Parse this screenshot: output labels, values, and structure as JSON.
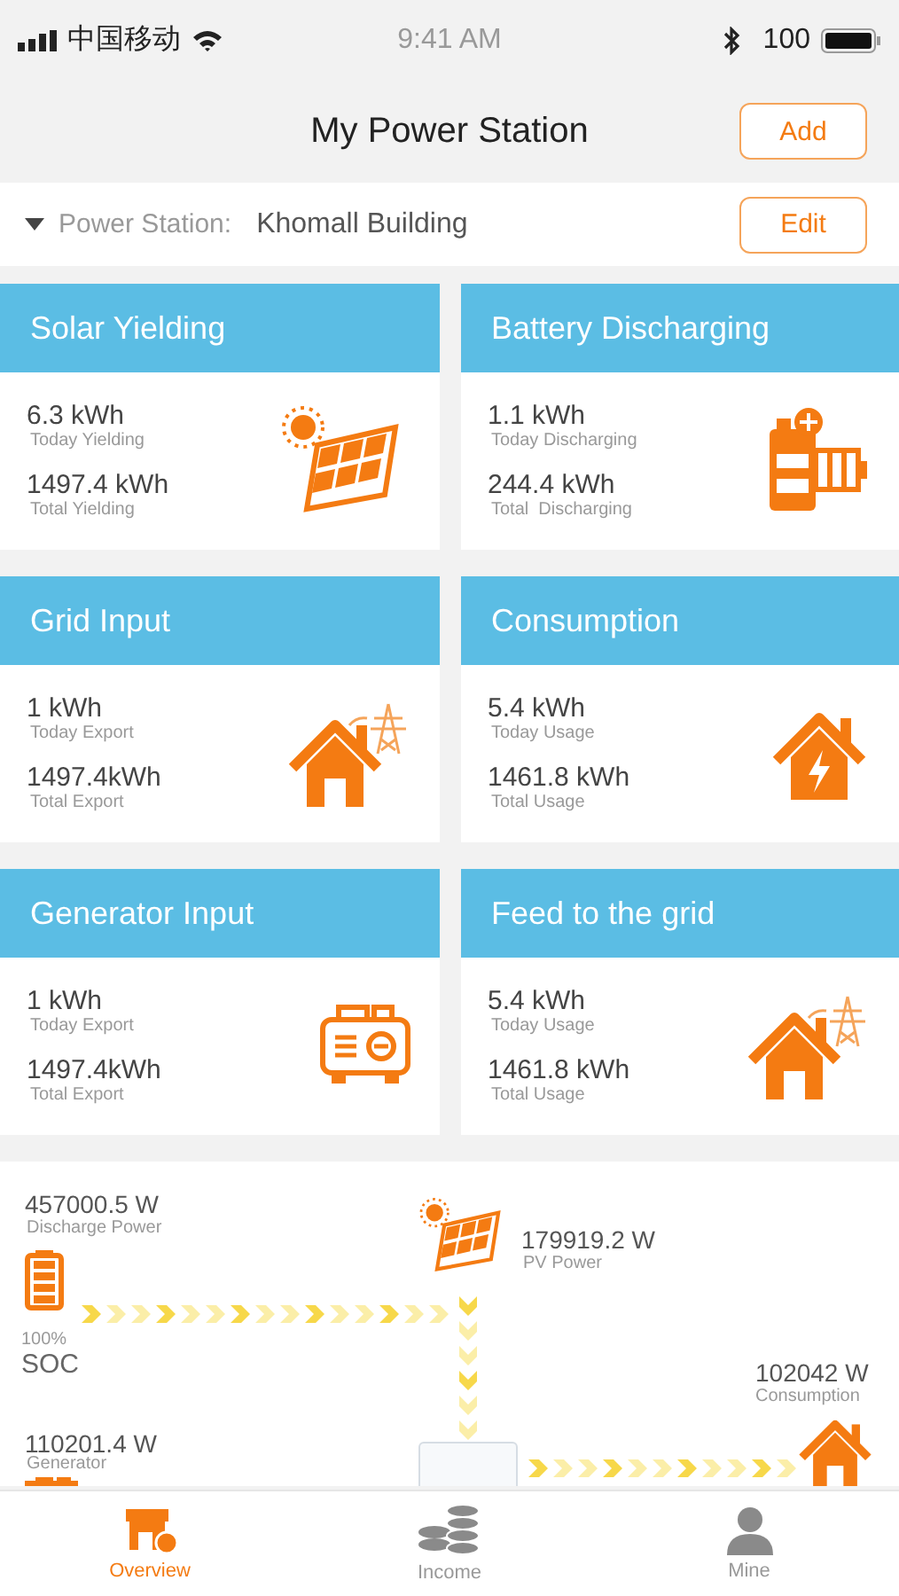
{
  "status_bar": {
    "carrier": "中国移动",
    "time": "9:41 AM",
    "battery": "100"
  },
  "header": {
    "title": "My Power Station",
    "add_button": "Add"
  },
  "station": {
    "label": "Power Station:",
    "name": "Khomall Building",
    "edit_button": "Edit"
  },
  "cards": [
    {
      "title": "Solar Yielding",
      "kind": "solar",
      "stats": [
        {
          "value": "6.3 kWh",
          "label": "Today Yielding"
        },
        {
          "value": "1497.4 kWh",
          "label": "Total Yielding"
        }
      ]
    },
    {
      "title": "Battery Discharging",
      "kind": "battery",
      "stats": [
        {
          "value": "1.1 kWh",
          "label": "Today Discharging"
        },
        {
          "value": "244.4 kWh",
          "label": "Total  Discharging"
        }
      ]
    },
    {
      "title": "Grid Input",
      "kind": "grid",
      "stats": [
        {
          "value": "1 kWh",
          "label": "Today Export"
        },
        {
          "value": "1497.4kWh",
          "label": "Total Export"
        }
      ]
    },
    {
      "title": "Consumption",
      "kind": "consumption",
      "stats": [
        {
          "value": "5.4 kWh",
          "label": "Today Usage"
        },
        {
          "value": "1461.8 kWh",
          "label": "Total Usage"
        }
      ]
    },
    {
      "title": "Generator Input",
      "kind": "generator",
      "stats": [
        {
          "value": "1 kWh",
          "label": "Today Export"
        },
        {
          "value": "1497.4kWh",
          "label": "Total Export"
        }
      ]
    },
    {
      "title": "Feed to the grid",
      "kind": "grid",
      "stats": [
        {
          "value": "5.4 kWh",
          "label": "Today Usage"
        },
        {
          "value": "1461.8 kWh",
          "label": "Total Usage"
        }
      ]
    }
  ],
  "flow": {
    "discharge": {
      "value": "457000.5 W",
      "label": "Discharge Power"
    },
    "soc": {
      "value": "100%",
      "label": "SOC"
    },
    "pv": {
      "value": "179919.2 W",
      "label": "PV Power"
    },
    "consumption": {
      "value": "102042 W",
      "label": "Consumption"
    },
    "generator": {
      "value": "110201.4 W",
      "label": "Generator"
    }
  },
  "tabs": [
    {
      "label": "Overview",
      "kind": "overview",
      "selected": true
    },
    {
      "label": "Income",
      "kind": "income",
      "selected": false
    },
    {
      "label": "Mine",
      "kind": "mine",
      "selected": false
    }
  ]
}
